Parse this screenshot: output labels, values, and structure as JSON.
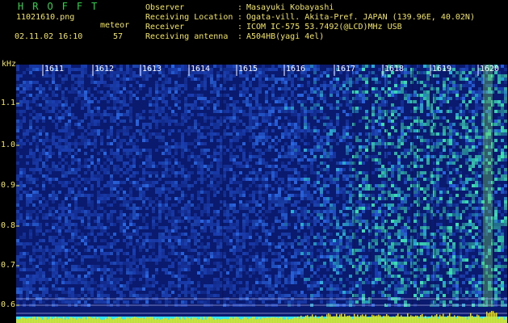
{
  "header": {
    "title": "HROFFT",
    "filename": "11021610.png",
    "datetime": "02.11.02 16:10",
    "meteor_label": "meteor",
    "meteor_count": "57"
  },
  "info": [
    {
      "key": "Observer",
      "value": "Masayuki Kobayashi"
    },
    {
      "key": "Receiving Location",
      "value": "Ogata-vill. Akita-Pref. JAPAN (139.96E, 40.02N)"
    },
    {
      "key": "Receiver",
      "value": "ICOM IC-575 53.7492(@LCD)MHz USB"
    },
    {
      "key": "Receiving antenna",
      "value": "A504HB(yagi 4el)"
    }
  ],
  "chart_data": {
    "type": "heatmap",
    "ylabel": "kHz",
    "y_ticks": [
      "1.1",
      "1.0",
      "0.9",
      "0.8",
      "0.7",
      "0.6"
    ],
    "time_labels": [
      "1611",
      "1612",
      "1613",
      "1614",
      "1615",
      "1616",
      "1617",
      "1618",
      "1619",
      "1620"
    ],
    "colors": {
      "bg": "#0a1a6e",
      "noise": "#1f4fd8",
      "hot": "#2fd0a0",
      "bar": "#f2e000"
    }
  }
}
